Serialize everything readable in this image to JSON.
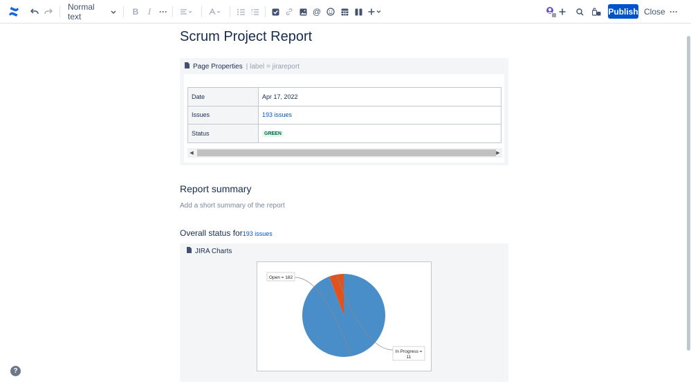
{
  "toolbar": {
    "text_style": "Normal text",
    "publish_label": "Publish",
    "close_label": "Close"
  },
  "page": {
    "title": "Scrum Project Report"
  },
  "page_properties": {
    "macro_name": "Page Properties",
    "macro_param": "| label = jirareport",
    "rows": [
      {
        "key": "Date",
        "value": "Apr 17, 2022"
      },
      {
        "key": "Issues",
        "value": "193 issues"
      },
      {
        "key": "Status",
        "value": "GREEN"
      }
    ]
  },
  "report_summary": {
    "heading": "Report summary",
    "placeholder": "Add a short summary of the report"
  },
  "overall_status": {
    "label": "Overall status for",
    "link": "193 issues"
  },
  "jira_charts": {
    "macro_name": "JIRA Charts"
  },
  "chart_data": {
    "type": "pie",
    "categories": [
      "Open",
      "In Progress"
    ],
    "values": [
      182,
      11
    ],
    "labels": [
      "Open = 182",
      "In Progress = 11"
    ],
    "colors": [
      "#4a8ec9",
      "#e0531e"
    ]
  },
  "colors": {
    "primary": "#0052cc",
    "status_green_bg": "#e3fcef",
    "status_green_text": "#006644"
  }
}
